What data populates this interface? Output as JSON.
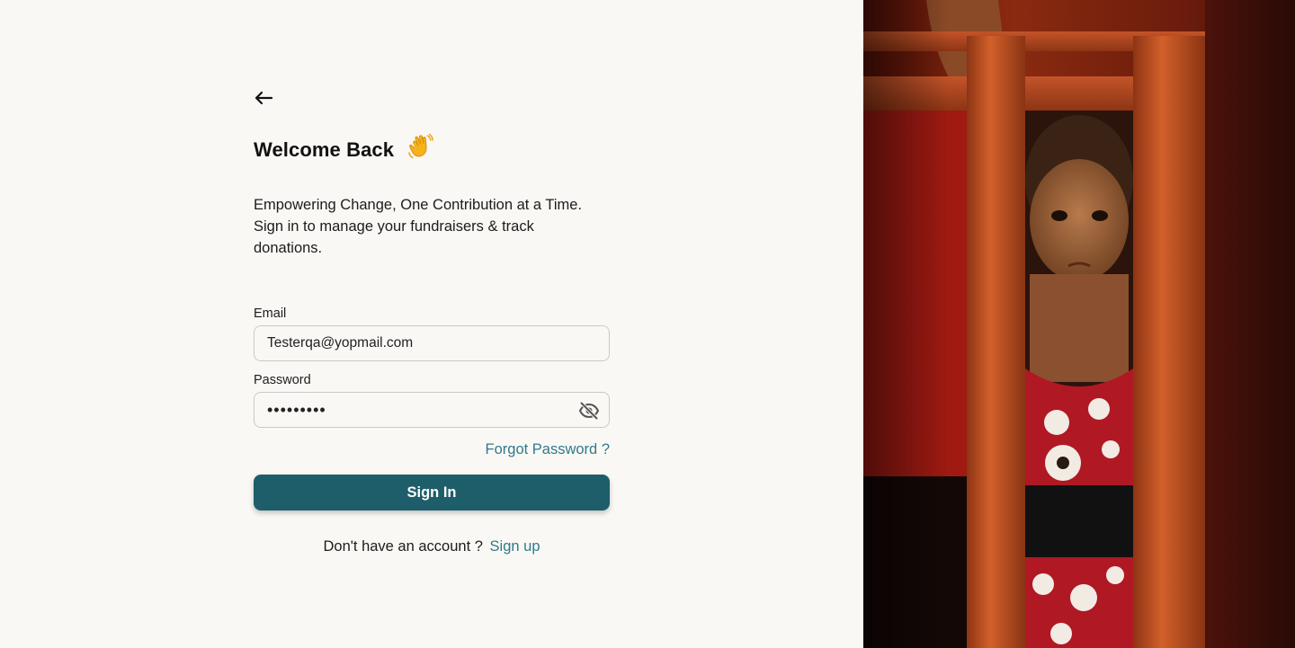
{
  "header": {
    "back_icon": "arrow-left-icon"
  },
  "welcome": {
    "title": "Welcome Back",
    "icon": "waving-hand-icon",
    "subtitle_line1": "Empowering Change, One Contribution at a Time.",
    "subtitle_line2": "Sign in to manage your fundraisers & track donations."
  },
  "form": {
    "email_label": "Email",
    "email_value": "Testerqa@yopmail.com",
    "password_label": "Password",
    "password_value": "•••••••••",
    "password_toggle_icon": "eye-off-icon",
    "forgot_label": "Forgot Password ?",
    "submit_label": "Sign In"
  },
  "footer": {
    "prompt": "Don't have an account ?",
    "signup_label": "Sign up"
  },
  "colors": {
    "background": "#faf8f5",
    "primary_button": "#1e5e6b",
    "link": "#2e7a8c",
    "border": "#c9c9c9"
  },
  "hero_image": {
    "icon": "photo-child-behind-orange-crates"
  }
}
